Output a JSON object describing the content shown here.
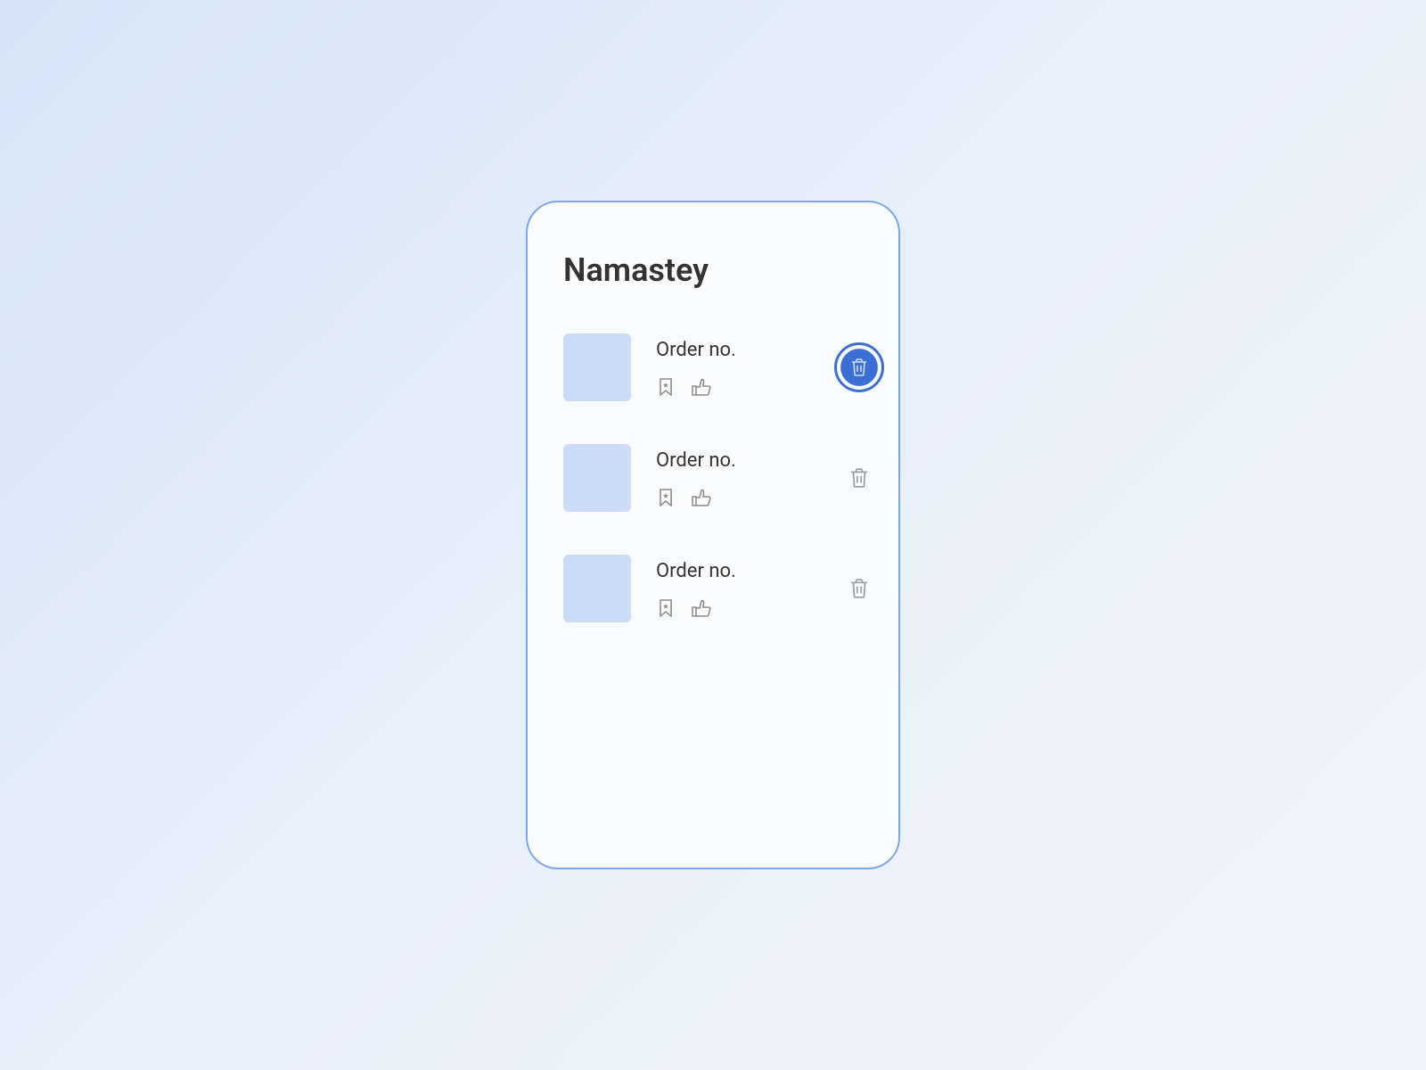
{
  "page": {
    "title": "Namastey"
  },
  "orders": [
    {
      "label": "Order no.",
      "delete_highlighted": true
    },
    {
      "label": "Order no.",
      "delete_highlighted": false
    },
    {
      "label": "Order no.",
      "delete_highlighted": false
    }
  ],
  "colors": {
    "accent": "#3b6fd6",
    "thumbnail": "#cddcf6",
    "border": "#7ea6e8",
    "text": "#333333",
    "icon_muted": "#8e8e8e"
  }
}
